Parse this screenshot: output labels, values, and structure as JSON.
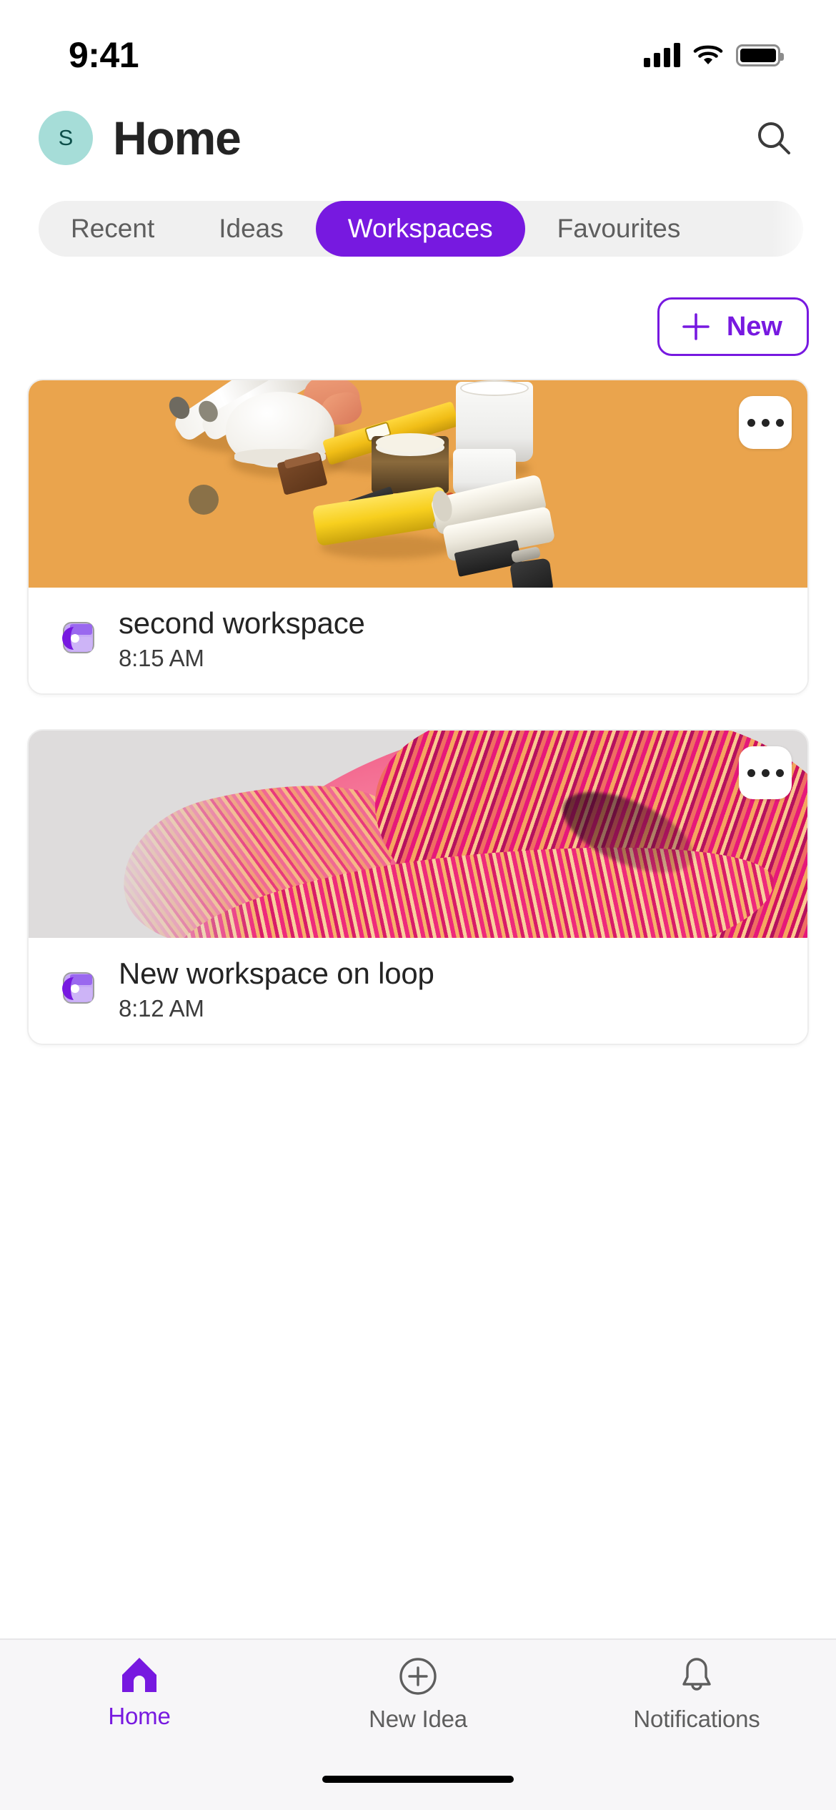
{
  "status_bar": {
    "time": "9:41",
    "signal_icon": "cellular-signal-icon",
    "wifi_icon": "wifi-icon",
    "battery_icon": "battery-full-icon"
  },
  "header": {
    "avatar_initial": "S",
    "avatar_bg": "#a6ddd8",
    "title": "Home",
    "search_icon": "search-icon"
  },
  "tabs": [
    {
      "label": "Recent",
      "active": false
    },
    {
      "label": "Ideas",
      "active": false
    },
    {
      "label": "Workspaces",
      "active": true
    },
    {
      "label": "Favourites",
      "active": false
    }
  ],
  "toolbar": {
    "new_label": "New",
    "new_icon": "plus-icon"
  },
  "workspaces": [
    {
      "title": "second workspace",
      "time": "8:15 AM",
      "cover": "construction-tools-on-orange",
      "cover_bg": "#eaa44d",
      "app_icon": "loop-workspace-icon",
      "more_icon": "more-horizontal-icon"
    },
    {
      "title": "New workspace on loop",
      "time": "8:12 AM",
      "cover": "pink-abstract-ribbon",
      "cover_bg": "#dedcdc",
      "app_icon": "loop-workspace-icon",
      "more_icon": "more-horizontal-icon"
    }
  ],
  "bottom_nav": [
    {
      "label": "Home",
      "icon": "home-icon",
      "active": true
    },
    {
      "label": "New Idea",
      "icon": "plus-circle-icon",
      "active": false
    },
    {
      "label": "Notifications",
      "icon": "bell-icon",
      "active": false
    }
  ],
  "theme": {
    "accent": "#7719e0",
    "text_primary": "#242424",
    "text_secondary": "#5e5e5e",
    "tabstrip_bg": "#f0f0f0",
    "nav_bg": "#f7f6f8"
  }
}
